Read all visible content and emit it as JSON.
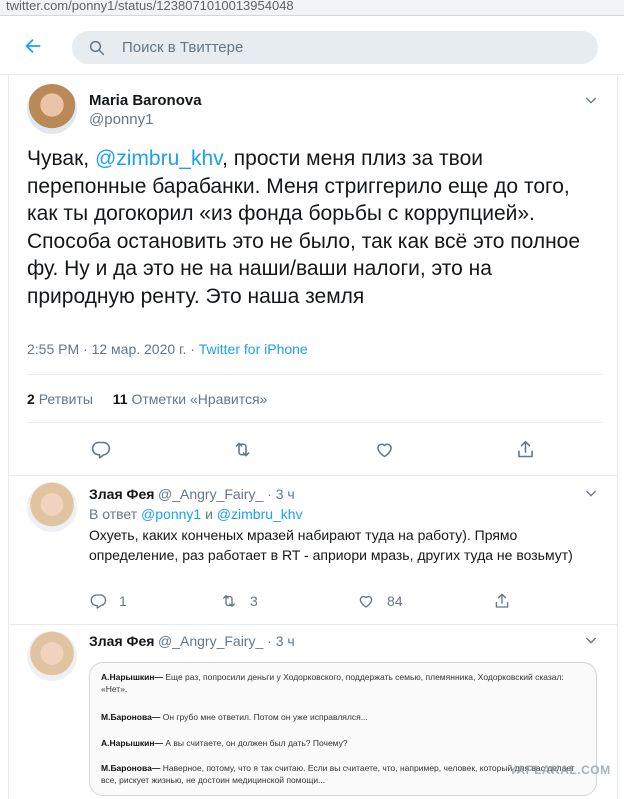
{
  "browser": {
    "url": "twitter.com/ponny1/status/1238071010013954048"
  },
  "header": {
    "search_placeholder": "Поиск в Твиттере"
  },
  "main_tweet": {
    "author_name": "Maria Baronova",
    "author_handle": "@ponny1",
    "text_before": "Чувак, ",
    "mention": "@zimbru_khv",
    "text_after": ", прости меня плиз за твои перепонные барабанки. Меня стриггерило еще до того, как ты догокорил «из фонда борьбы с коррупцией». Способа остановить это не было, так как всё это полное фу. Ну и да это не на наши/ваши налоги, это на природную ренту. Это наша земля",
    "timestamp": "2:55 PM · 12 мар. 2020 г. · ",
    "source": "Twitter for iPhone",
    "retweets_count": "2",
    "retweets_label": "Ретвиты",
    "likes_count": "11",
    "likes_label": "Отметки «Нравится»"
  },
  "replies": [
    {
      "author_name": "Злая Фея",
      "author_handle": "@_Angry_Fairy_ · 3 ч",
      "reply_prefix": "В ответ ",
      "reply_user1": "@ponny1",
      "reply_and": " и ",
      "reply_user2": "@zimbru_khv",
      "text": "Охуеть, каких конченых мразей набирают туда на работу). Прямо определение, раз работает в RT - априори мразь, других туда не возьмут)",
      "replies_count": "1",
      "retweets_count": "3",
      "likes_count": "84"
    },
    {
      "author_name": "Злая Фея",
      "author_handle": "@_Angry_Fairy_ · 3 ч",
      "quote": {
        "lines": [
          {
            "speaker": "А.Нарышкин—",
            "text": " Еще раз, попросили деньги у Ходорковского, поддержать семью, племянника, Ходорковский сказал: «Нет»."
          },
          {
            "speaker": "М.Баронова—",
            "text": " Он грубо мне ответил. Потом он уже исправлялся..."
          },
          {
            "speaker": "А.Нарышкин—",
            "text": " А вы считаете, он должен был дать? Почему?"
          },
          {
            "speaker": "М.Баронова—",
            "text": " Наверное, потому, что я так считаю. Если вы считаете, что, например, человек, который для вас делает все, рискует жизнью, не достоин медицинской помощи..."
          }
        ]
      }
    }
  ],
  "watermark": "YAPLAKAL.COM",
  "colors": {
    "accent": "#1da1f2",
    "secondary_text": "#657786",
    "divider": "#e6ecf0"
  }
}
